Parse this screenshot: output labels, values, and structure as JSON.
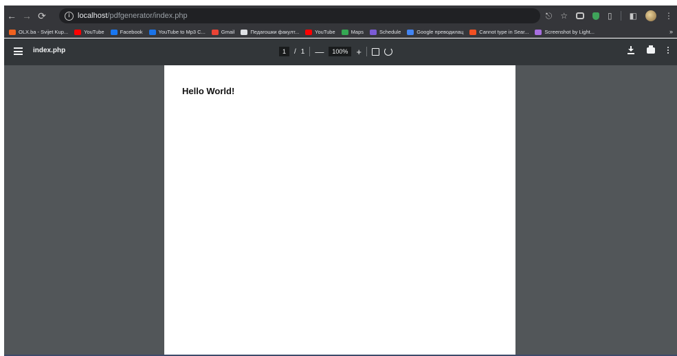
{
  "browser": {
    "url_host": "localhost",
    "url_path": "/pdfgenerator/index.php",
    "back_icon": "arrow-left-icon",
    "forward_icon": "arrow-right-icon",
    "reload_icon": "reload-icon"
  },
  "bookmarks": [
    {
      "label": "OLX.ba - Svijet Kup...",
      "color": "#f0621f"
    },
    {
      "label": "YouTube",
      "color": "#ff0000"
    },
    {
      "label": "Facebook",
      "color": "#1877f2"
    },
    {
      "label": "YouTube to Mp3 C...",
      "color": "#1a73e8"
    },
    {
      "label": "Gmail",
      "color": "#ea4335"
    },
    {
      "label": "Педагошки факулт...",
      "color": "#dfe1e5"
    },
    {
      "label": "YouTube",
      "color": "#ff0000"
    },
    {
      "label": "Maps",
      "color": "#34a853"
    },
    {
      "label": "Schedule",
      "color": "#7b5bd6"
    },
    {
      "label": "Google преводилац",
      "color": "#4285f4"
    },
    {
      "label": "Cannot type in Sear...",
      "color": "#f25022"
    },
    {
      "label": "Screenshot by Light...",
      "color": "#a86fe0"
    }
  ],
  "bookmarks_more": "»",
  "pdf_viewer": {
    "file_title": "index.php",
    "current_page": "1",
    "page_separator": "/",
    "total_pages": "1",
    "zoom_out": "—",
    "zoom_level": "100%",
    "zoom_in": "+"
  },
  "document": {
    "text": "Hello World!"
  }
}
